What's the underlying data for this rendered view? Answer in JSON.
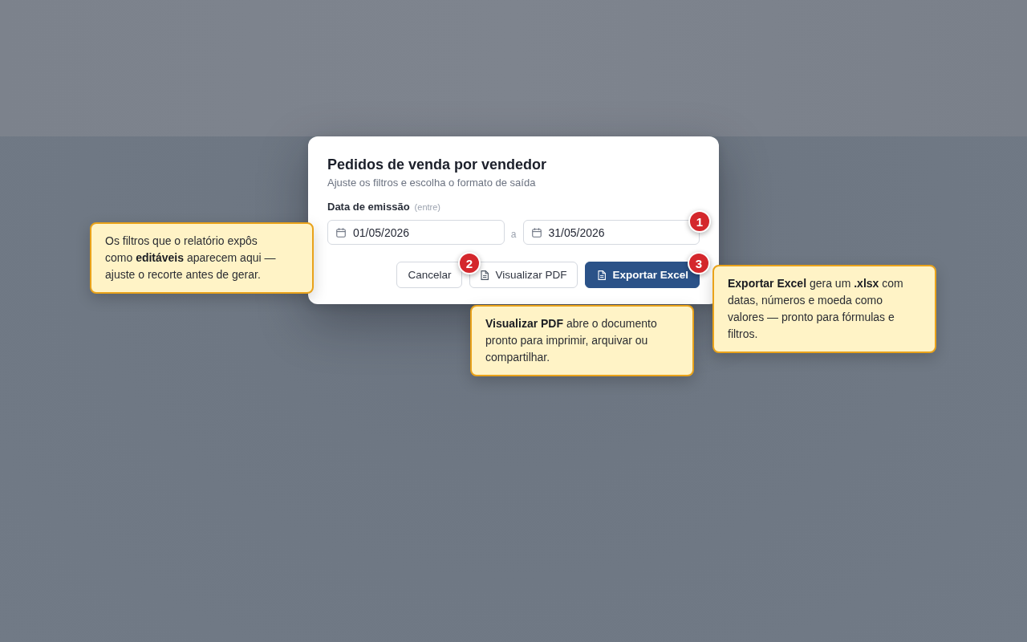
{
  "dialog": {
    "title": "Pedidos de venda por vendedor",
    "subtitle": "Ajuste os filtros e escolha o formato de saída",
    "date_filter": {
      "label": "Data de emissão",
      "hint": "(entre)",
      "from": "01/05/2026",
      "separator": "a",
      "to": "31/05/2026"
    },
    "buttons": [
      {
        "label": "Cancelar",
        "kind": "plain"
      },
      {
        "label": "Visualizar PDF",
        "kind": "document"
      },
      {
        "label": "Exportar Excel",
        "kind": "primary"
      }
    ]
  },
  "markers": [
    "1",
    "2",
    "3"
  ],
  "callouts": [
    {
      "text": "Os filtros que o relatório expôs como **editáveis** aparecem aqui — ajuste o recorte antes de gerar."
    },
    {
      "text": "**Visualizar PDF** abre o documento pronto para imprimir, arquivar ou compartilhar."
    },
    {
      "text": "**Exportar Excel** gera um **.xlsx** com datas, números e moeda como valores — pronto para fórmulas e filtros."
    }
  ]
}
